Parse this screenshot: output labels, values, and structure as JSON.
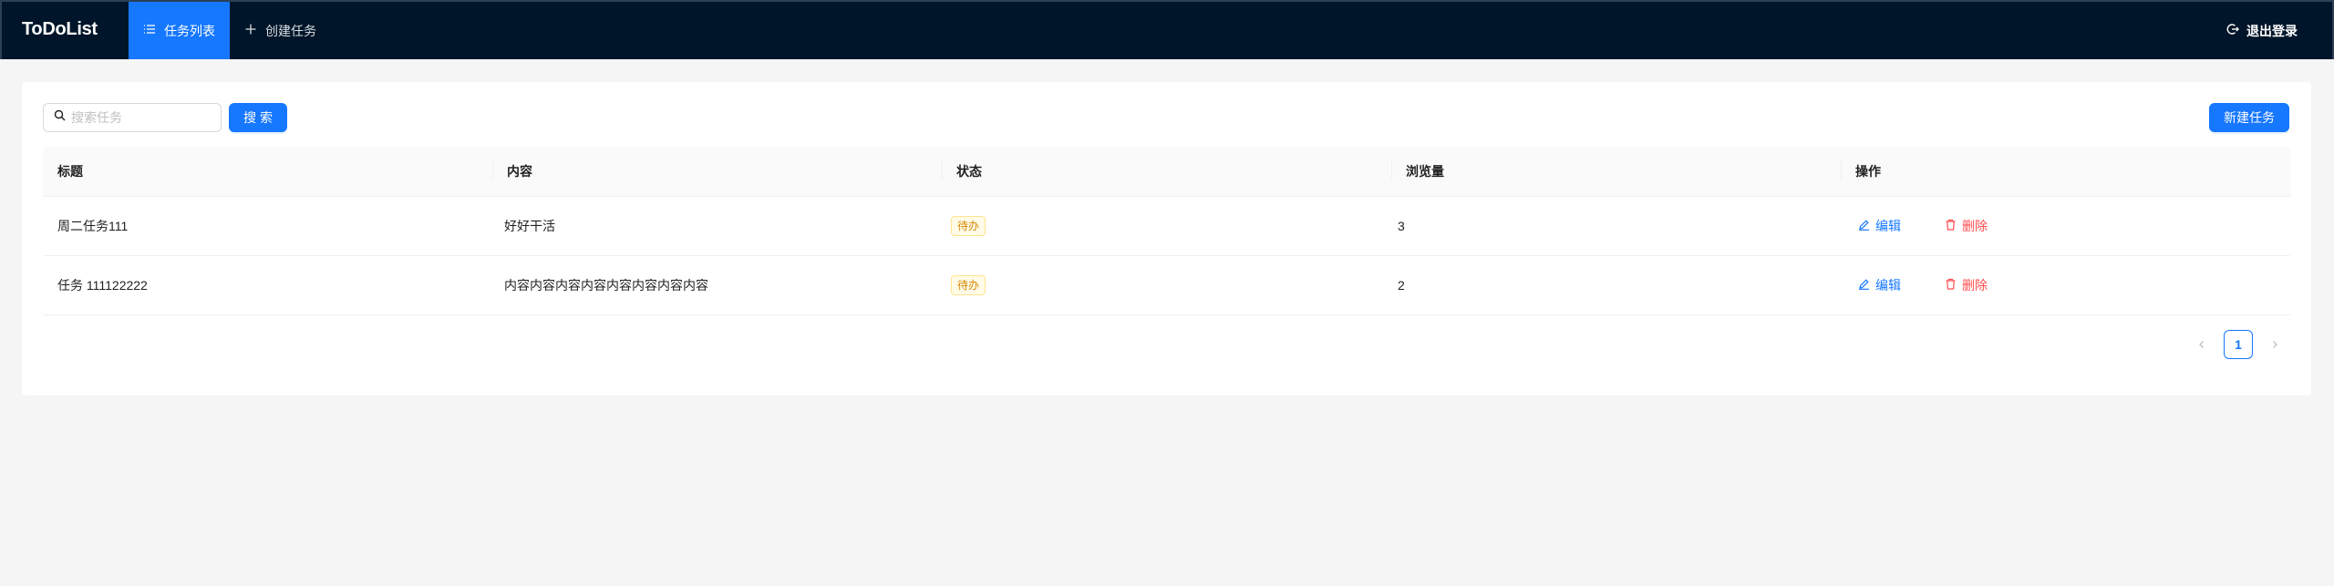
{
  "header": {
    "logo": "ToDoList",
    "nav": [
      {
        "label": "任务列表",
        "icon": "list-icon",
        "active": true
      },
      {
        "label": "创建任务",
        "icon": "plus-icon",
        "active": false
      }
    ],
    "logout_label": "退出登录",
    "logout_icon": "logout-icon"
  },
  "toolbar": {
    "search_placeholder": "搜索任务",
    "search_value": "",
    "search_button": "搜索",
    "new_button": "新建任务"
  },
  "table": {
    "columns": [
      "标题",
      "内容",
      "状态",
      "浏览量",
      "操作"
    ],
    "rows": [
      {
        "title": "周二任务111",
        "content": "好好干活",
        "status": "待办",
        "views": "3",
        "edit": "编辑",
        "delete": "删除"
      },
      {
        "title": "任务 111122222",
        "content": "内容内容内容内容内容内容内容内容",
        "status": "待办",
        "views": "2",
        "edit": "编辑",
        "delete": "删除"
      }
    ]
  },
  "pagination": {
    "current_page": "1"
  },
  "colors": {
    "header_bg": "#001529",
    "accent": "#1677ff",
    "danger": "#ff4d4f",
    "tag_text": "#d48806",
    "tag_bg": "#fffbe6"
  }
}
